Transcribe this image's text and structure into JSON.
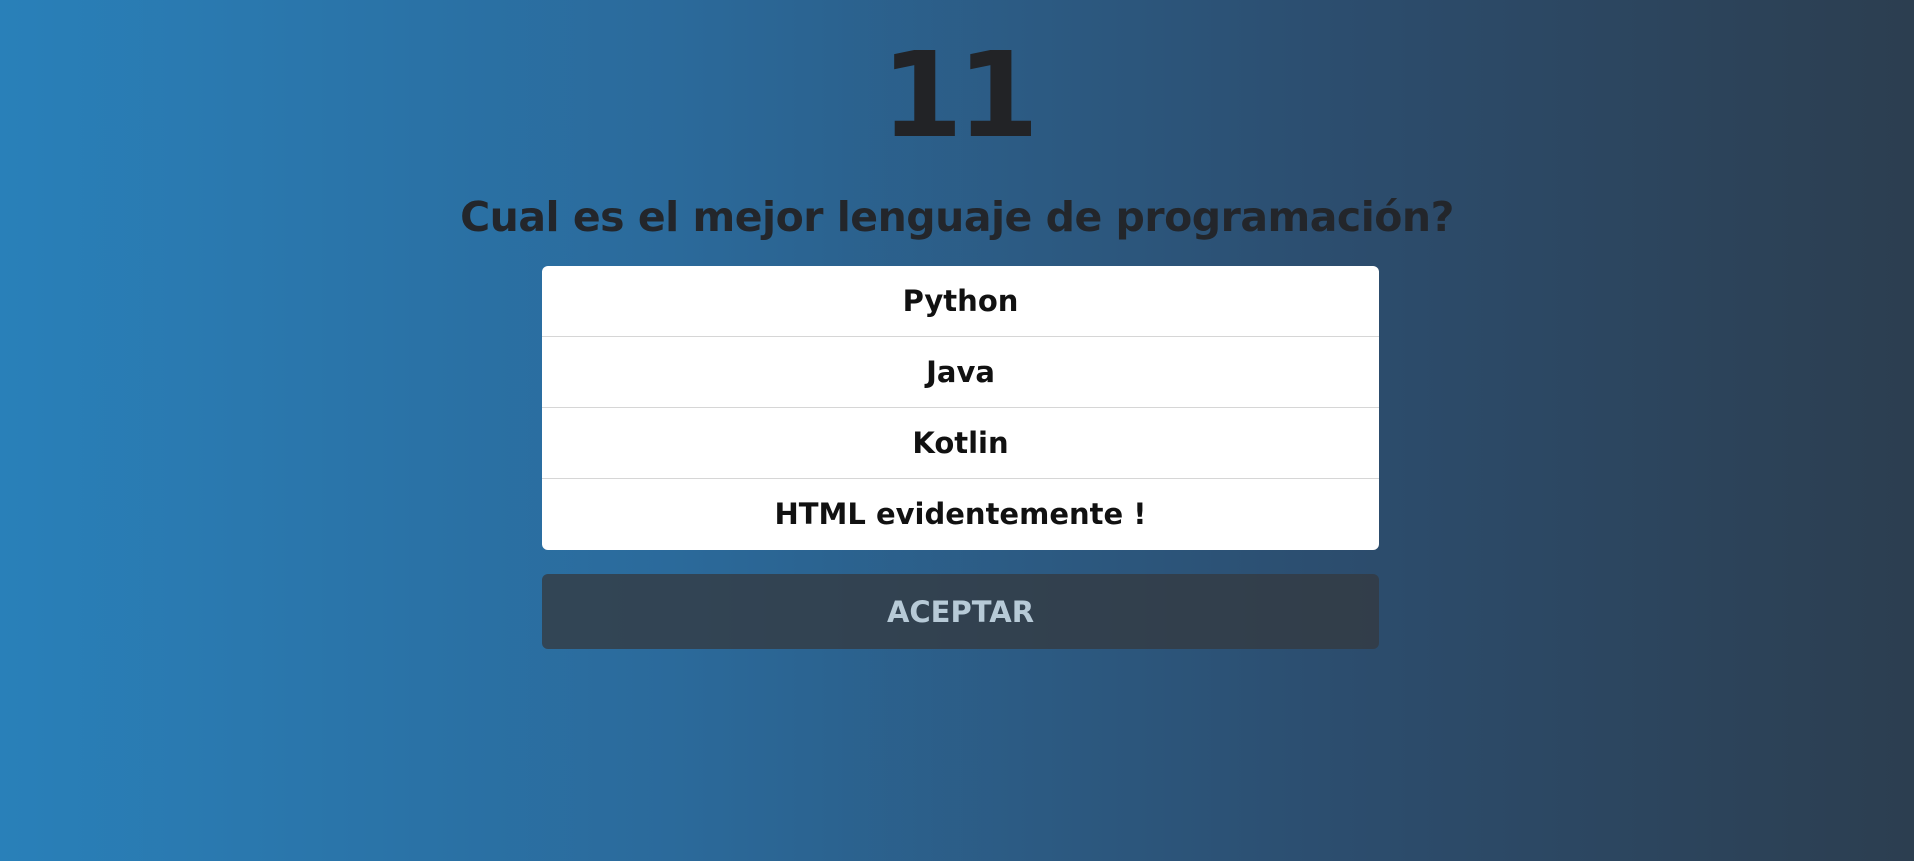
{
  "quiz": {
    "counter": "11",
    "question": "Cual es el mejor lenguaje de programación?",
    "options": [
      {
        "label": "Python"
      },
      {
        "label": "Java"
      },
      {
        "label": "Kotlin"
      },
      {
        "label": "HTML evidentemente !"
      }
    ],
    "accept_label": "ACEPTAR"
  },
  "colors": {
    "gradient_start": "#2980b9",
    "gradient_end": "#2c3e50",
    "heading_text": "#222326",
    "option_background": "#ffffff",
    "button_text": "#b7cad7"
  }
}
